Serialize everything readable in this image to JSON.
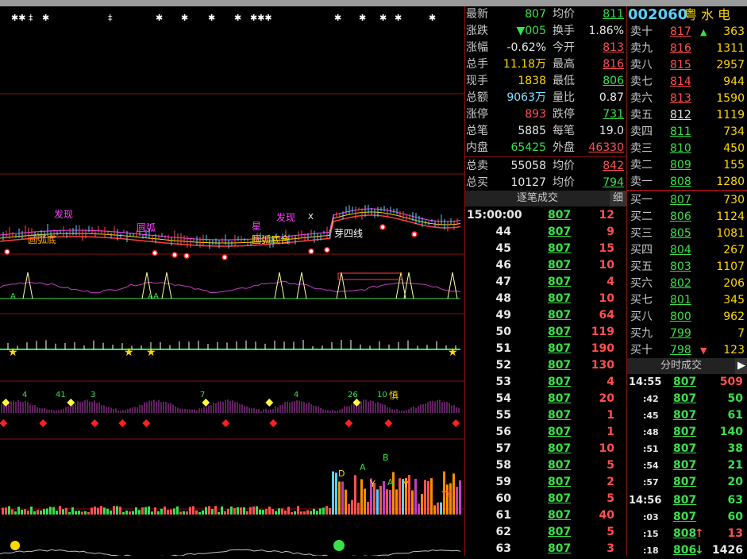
{
  "stock": {
    "code": "002060",
    "name": "粤 水 电"
  },
  "quote_left": [
    {
      "label": "最新",
      "value": "807",
      "vcolor": "green"
    },
    {
      "label": "涨跌",
      "value": "▼005",
      "vcolor": "green"
    },
    {
      "label": "涨幅",
      "value": "-0.62%",
      "vcolor": "white"
    },
    {
      "label": "总手",
      "value": "11.18万",
      "vcolor": "yellow"
    },
    {
      "label": "现手",
      "value": "1838",
      "vcolor": "yellow"
    },
    {
      "label": "总额",
      "value": "9063万",
      "vcolor": "cyan"
    },
    {
      "label": "涨停",
      "value": "893",
      "vcolor": "red"
    },
    {
      "label": "总笔",
      "value": "5885",
      "vcolor": "white"
    },
    {
      "label": "内盘",
      "value": "65425",
      "vcolor": "green"
    },
    {
      "label": "总卖",
      "value": "55058",
      "vcolor": "white"
    },
    {
      "label": "总买",
      "value": "10127",
      "vcolor": "white"
    }
  ],
  "quote_right": [
    {
      "label": "均价",
      "value": "811",
      "vcolor": "green"
    },
    {
      "label": "换手",
      "value": "1.86%",
      "vcolor": "white"
    },
    {
      "label": "今开",
      "value": "813",
      "vcolor": "red"
    },
    {
      "label": "最高",
      "value": "816",
      "vcolor": "red"
    },
    {
      "label": "最低",
      "value": "806",
      "vcolor": "green"
    },
    {
      "label": "量比",
      "value": "0.87",
      "vcolor": "white"
    },
    {
      "label": "跌停",
      "value": "731",
      "vcolor": "green"
    },
    {
      "label": "每笔",
      "value": "19.0",
      "vcolor": "white"
    },
    {
      "label": "外盘",
      "value": "46330",
      "vcolor": "red"
    },
    {
      "label": "均价",
      "value": "842",
      "vcolor": "red"
    },
    {
      "label": "均价",
      "value": "794",
      "vcolor": "green"
    }
  ],
  "order_book": {
    "sell": [
      {
        "label": "卖十",
        "price": "817",
        "pcolor": "red",
        "arrow": "▲",
        "qty": "363"
      },
      {
        "label": "卖九",
        "price": "816",
        "pcolor": "red",
        "arrow": "",
        "qty": "1311"
      },
      {
        "label": "卖八",
        "price": "815",
        "pcolor": "red",
        "arrow": "",
        "qty": "2957"
      },
      {
        "label": "卖七",
        "price": "814",
        "pcolor": "red",
        "arrow": "",
        "qty": "944"
      },
      {
        "label": "卖六",
        "price": "813",
        "pcolor": "red",
        "arrow": "",
        "qty": "1590"
      },
      {
        "label": "卖五",
        "price": "812",
        "pcolor": "white",
        "arrow": "",
        "qty": "1119"
      },
      {
        "label": "卖四",
        "price": "811",
        "pcolor": "green",
        "arrow": "",
        "qty": "734"
      },
      {
        "label": "卖三",
        "price": "810",
        "pcolor": "green",
        "arrow": "",
        "qty": "450"
      },
      {
        "label": "卖二",
        "price": "809",
        "pcolor": "green",
        "arrow": "",
        "qty": "155"
      },
      {
        "label": "卖一",
        "price": "808",
        "pcolor": "green",
        "arrow": "",
        "qty": "1280"
      }
    ],
    "buy": [
      {
        "label": "买一",
        "price": "807",
        "pcolor": "green",
        "arrow": "",
        "qty": "730"
      },
      {
        "label": "买二",
        "price": "806",
        "pcolor": "green",
        "arrow": "",
        "qty": "1124"
      },
      {
        "label": "买三",
        "price": "805",
        "pcolor": "green",
        "arrow": "",
        "qty": "1081"
      },
      {
        "label": "买四",
        "price": "804",
        "pcolor": "green",
        "arrow": "",
        "qty": "267"
      },
      {
        "label": "买五",
        "price": "803",
        "pcolor": "green",
        "arrow": "",
        "qty": "1107"
      },
      {
        "label": "买六",
        "price": "802",
        "pcolor": "green",
        "arrow": "",
        "qty": "206"
      },
      {
        "label": "买七",
        "price": "801",
        "pcolor": "green",
        "arrow": "",
        "qty": "345"
      },
      {
        "label": "买八",
        "price": "800",
        "pcolor": "green",
        "arrow": "",
        "qty": "962"
      },
      {
        "label": "买九",
        "price": "799",
        "pcolor": "green",
        "arrow": "",
        "qty": "7"
      },
      {
        "label": "买十",
        "price": "798",
        "pcolor": "green",
        "arrow": "▼",
        "qty": "123"
      }
    ]
  },
  "tick_panel": {
    "title": "逐笔成交",
    "detail_btn": "细",
    "rows": [
      {
        "t": "15:00:00",
        "p": "807",
        "v": "12"
      },
      {
        "t": "44",
        "p": "807",
        "v": "9"
      },
      {
        "t": "45",
        "p": "807",
        "v": "15"
      },
      {
        "t": "46",
        "p": "807",
        "v": "10"
      },
      {
        "t": "47",
        "p": "807",
        "v": "4"
      },
      {
        "t": "48",
        "p": "807",
        "v": "10"
      },
      {
        "t": "49",
        "p": "807",
        "v": "64"
      },
      {
        "t": "50",
        "p": "807",
        "v": "119"
      },
      {
        "t": "51",
        "p": "807",
        "v": "190"
      },
      {
        "t": "52",
        "p": "807",
        "v": "130"
      },
      {
        "t": "53",
        "p": "807",
        "v": "4"
      },
      {
        "t": "54",
        "p": "807",
        "v": "20"
      },
      {
        "t": "55",
        "p": "807",
        "v": "1"
      },
      {
        "t": "56",
        "p": "807",
        "v": "1"
      },
      {
        "t": "57",
        "p": "807",
        "v": "10"
      },
      {
        "t": "58",
        "p": "807",
        "v": "5"
      },
      {
        "t": "59",
        "p": "807",
        "v": "2"
      },
      {
        "t": "60",
        "p": "807",
        "v": "5"
      },
      {
        "t": "61",
        "p": "807",
        "v": "40"
      },
      {
        "t": "62",
        "p": "807",
        "v": "5"
      },
      {
        "t": "63",
        "p": "807",
        "v": "3"
      }
    ]
  },
  "minute_panel": {
    "title": "分时成交",
    "arrow_btn": "▶",
    "rows": [
      {
        "t": "14:55",
        "p": "807",
        "pcolor": "green",
        "arrow": "",
        "v": "509",
        "vcolor": "red"
      },
      {
        "t": ":42",
        "p": "807",
        "pcolor": "green",
        "arrow": "",
        "v": "50",
        "vcolor": "green"
      },
      {
        "t": ":45",
        "p": "807",
        "pcolor": "green",
        "arrow": "",
        "v": "61",
        "vcolor": "green"
      },
      {
        "t": ":48",
        "p": "807",
        "pcolor": "green",
        "arrow": "",
        "v": "140",
        "vcolor": "green"
      },
      {
        "t": ":51",
        "p": "807",
        "pcolor": "green",
        "arrow": "",
        "v": "38",
        "vcolor": "green"
      },
      {
        "t": ":54",
        "p": "807",
        "pcolor": "green",
        "arrow": "",
        "v": "21",
        "vcolor": "green"
      },
      {
        "t": ":57",
        "p": "807",
        "pcolor": "green",
        "arrow": "",
        "v": "20",
        "vcolor": "green"
      },
      {
        "t": "14:56",
        "p": "807",
        "pcolor": "green",
        "arrow": "",
        "v": "63",
        "vcolor": "green"
      },
      {
        "t": ":03",
        "p": "807",
        "pcolor": "green",
        "arrow": "",
        "v": "60",
        "vcolor": "green"
      },
      {
        "t": ":15",
        "p": "808",
        "pcolor": "green",
        "arrow": "↑",
        "v": "13",
        "vcolor": "red"
      },
      {
        "t": ":18",
        "p": "806",
        "pcolor": "green",
        "arrow": "↓",
        "v": "1426",
        "vcolor": "white"
      }
    ]
  },
  "chart_labels": {
    "k1": "发现",
    "k2": "圆弧底",
    "k3": "圆弧",
    "k4": "星",
    "k5": "发现",
    "k6": "圆弧底合",
    "k7": "芽四线",
    "k8": "X",
    "m1": "A",
    "m2": "AA",
    "v1": "4",
    "v2": "41",
    "v3": "3",
    "v4": "7",
    "v5": "4",
    "v6": "26",
    "v7": "10",
    "v8": "慎",
    "w1": "D",
    "w2": "A",
    "w3": "B",
    "w4": "Y",
    "w5": "A",
    "w6": "Y",
    "w7": "YY"
  },
  "colors": {
    "up": "#ff5050",
    "down": "#39e04a",
    "grid": "#8a1010",
    "bg": "#000000"
  }
}
